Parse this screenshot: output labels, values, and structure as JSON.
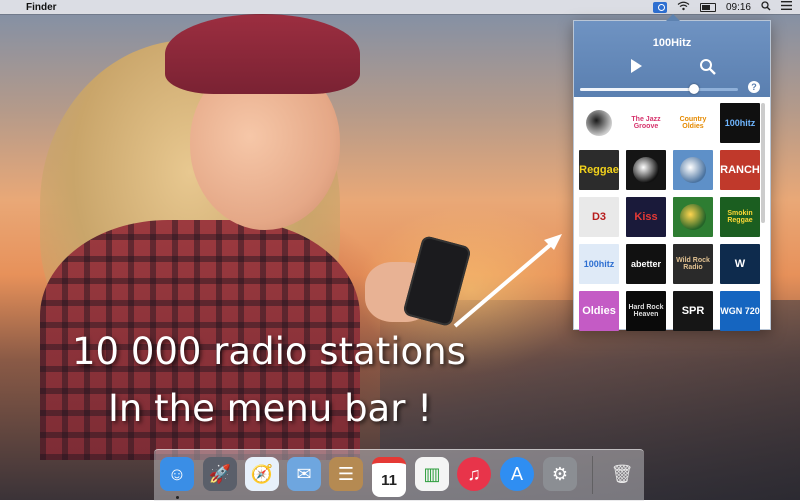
{
  "menubar": {
    "apple": "",
    "app_name": "Finder",
    "time": "09:16",
    "status_icons": [
      "radio-icon",
      "wifi-icon",
      "battery-icon",
      "spotlight-icon",
      "notification-list-icon"
    ]
  },
  "popup": {
    "title": "100Hitz",
    "help": "?",
    "volume": 0.72,
    "stations": [
      {
        "icon": "station-logo-emblem",
        "text": "",
        "bg": "#ffffff",
        "fg": "#1a1a1a"
      },
      {
        "icon": "station-logo-jazz-groove",
        "text": "The Jazz Groove",
        "bg": "#ffffff",
        "fg": "#d6336c"
      },
      {
        "icon": "station-logo-country-oldies",
        "text": "Country Oldies",
        "bg": "#ffffff",
        "fg": "#e58a00"
      },
      {
        "icon": "station-logo-100hitz",
        "text": "100hitz",
        "bg": "#101010",
        "fg": "#6fb6ff"
      },
      {
        "icon": "station-logo-reggae",
        "text": "Reggae",
        "bg": "#2c2c2c",
        "fg": "#f2d21b"
      },
      {
        "icon": "station-logo-singer-photo",
        "text": "",
        "bg": "#151515",
        "fg": "#ffffff"
      },
      {
        "icon": "station-logo-party-photo",
        "text": "",
        "bg": "#5e90c8",
        "fg": "#ffffff"
      },
      {
        "icon": "station-logo-ranch",
        "text": "RANCH",
        "bg": "#c0392b",
        "fg": "#ffffff"
      },
      {
        "icon": "station-logo-d3",
        "text": "D3",
        "bg": "#e9e9e9",
        "fg": "#b71c1c"
      },
      {
        "icon": "station-logo-kiss",
        "text": "Kiss",
        "bg": "#1a1a3a",
        "fg": "#e53935"
      },
      {
        "icon": "station-logo-lion",
        "text": "",
        "bg": "#2e7d32",
        "fg": "#ffd54f"
      },
      {
        "icon": "station-logo-smokin-reggae",
        "text": "Smokin Reggae",
        "bg": "#1b5e20",
        "fg": "#fdd835"
      },
      {
        "icon": "station-logo-100hitz-light",
        "text": "100hitz",
        "bg": "#dfeaf7",
        "fg": "#2e6fd1"
      },
      {
        "icon": "station-logo-abetter",
        "text": "abetter",
        "bg": "#111111",
        "fg": "#ffffff"
      },
      {
        "icon": "station-logo-wild-rock",
        "text": "Wild Rock Radio",
        "bg": "#2a2a2a",
        "fg": "#e0c090"
      },
      {
        "icon": "station-logo-w-blue",
        "text": "W",
        "bg": "#0e2b4d",
        "fg": "#ffffff"
      },
      {
        "icon": "station-logo-oldies",
        "text": "Oldies",
        "bg": "#c45bc5",
        "fg": "#ffffff"
      },
      {
        "icon": "station-logo-hard-rock-heaven",
        "text": "Hard Rock Heaven",
        "bg": "#0a0a0a",
        "fg": "#dddddd"
      },
      {
        "icon": "station-logo-spr",
        "text": "SPR",
        "bg": "#161616",
        "fg": "#ffffff"
      },
      {
        "icon": "station-logo-wgn",
        "text": "WGN 720",
        "bg": "#1565c0",
        "fg": "#ffffff"
      }
    ]
  },
  "tagline": {
    "line1": "10 000 radio stations",
    "line2": "In the menu bar !"
  },
  "dock": {
    "apps": [
      {
        "icon": "finder-icon",
        "glyph": "☺",
        "bg": "#3a8ee6",
        "fg": "#ffffff",
        "running": true
      },
      {
        "icon": "launchpad-icon",
        "glyph": "🚀",
        "bg": "#5a5f6a",
        "fg": "#ffffff",
        "running": false
      },
      {
        "icon": "safari-icon",
        "glyph": "🧭",
        "bg": "#e8f1fb",
        "fg": "#1e6fd6",
        "running": false
      },
      {
        "icon": "mail-icon",
        "glyph": "✉",
        "bg": "#6ea6df",
        "fg": "#ffffff",
        "running": false
      },
      {
        "icon": "contacts-icon",
        "glyph": "☰",
        "bg": "#b58a52",
        "fg": "#ffffff",
        "running": false
      },
      {
        "icon": "calendar-icon",
        "glyph": "11",
        "bg": "#ffffff",
        "fg": "#222222",
        "running": false
      },
      {
        "icon": "numbers-icon",
        "glyph": "▥",
        "bg": "#f4f4f4",
        "fg": "#2e9e3e",
        "running": false
      },
      {
        "icon": "itunes-icon",
        "glyph": "♫",
        "bg": "#e8344a",
        "fg": "#ffffff",
        "running": false
      },
      {
        "icon": "app-store-icon",
        "glyph": "A",
        "bg": "#2f8ef2",
        "fg": "#ffffff",
        "running": false
      },
      {
        "icon": "system-preferences-icon",
        "glyph": "⚙",
        "bg": "#8b8e93",
        "fg": "#ffffff",
        "running": false
      },
      {
        "icon": "trash-icon",
        "glyph": "🗑",
        "bg": "rgba(255,255,255,0.0)",
        "fg": "#e8e8e8",
        "running": false
      }
    ]
  }
}
